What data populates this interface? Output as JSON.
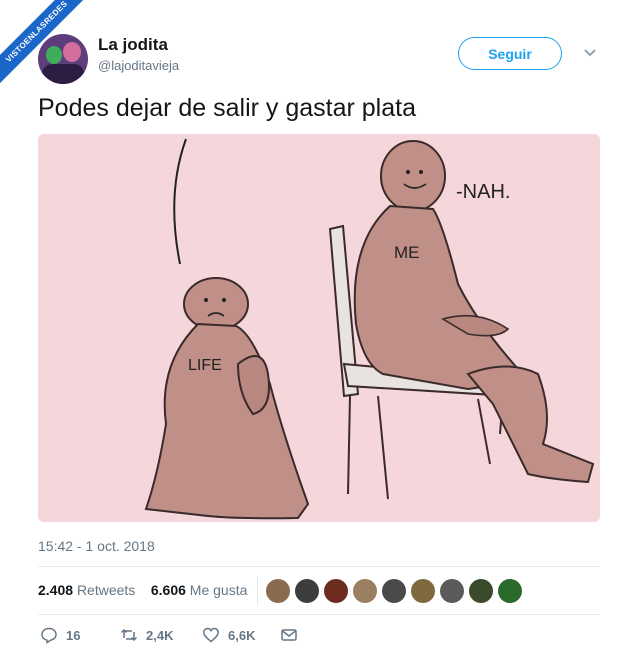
{
  "watermark": "VISTOENLASREDES",
  "user": {
    "name": "La jodita",
    "handle": "@lajoditavieja"
  },
  "follow_label": "Seguir",
  "tweet": {
    "text": "Podes dejar de salir y gastar plata"
  },
  "image": {
    "labels": {
      "life": "LIFE",
      "me": "ME",
      "nah": "-NAH."
    }
  },
  "timestamp": "15:42 - 1 oct. 2018",
  "stats": {
    "retweets_count": "2.408",
    "retweets_label": "Retweets",
    "likes_count": "6.606",
    "likes_label": "Me gusta"
  },
  "liker_colors": [
    "#8b6b4f",
    "#3d3d3d",
    "#6e2b1f",
    "#9a8060",
    "#4a4a4a",
    "#7f6a40",
    "#5a5a5a",
    "#3a4a2a",
    "#2a6a2a"
  ],
  "actions": {
    "replies": "16",
    "retweets": "2,4K",
    "likes": "6,6K"
  },
  "icons": {
    "reply": "reply-icon",
    "retweet": "retweet-icon",
    "like": "heart-icon",
    "dm": "envelope-icon",
    "menu": "chevron-down-icon"
  }
}
